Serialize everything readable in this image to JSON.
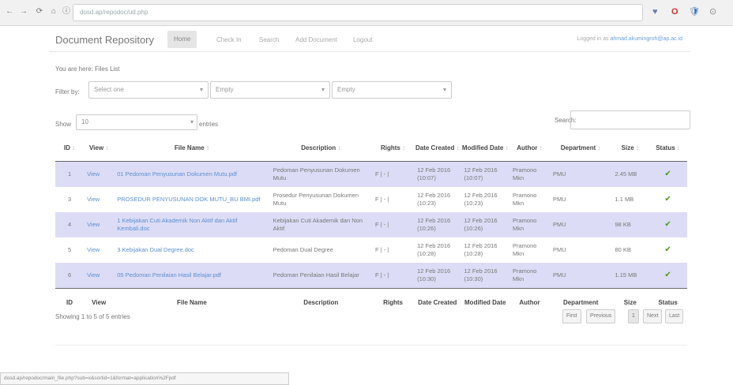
{
  "browser": {
    "url": "dosd.ap/repodoc/ud.php",
    "back_glyph": "←",
    "forward_glyph": "→",
    "reload_glyph": "⟳",
    "home_glyph": "⌂",
    "info_glyph": "ⓘ",
    "ext_glyphs": [
      "♥",
      "O",
      "🛡",
      "⊙"
    ],
    "status_url": "dosd.ap/repodoc/main_file.php?sub=x&sortid=1&format=application%2Fpdf"
  },
  "navbar": {
    "brand": "Document Repository",
    "links": [
      "Home",
      "Check In",
      "Search",
      "Add Document",
      "Logout"
    ],
    "logged_prefix": "Logged in as",
    "logged_user": "ahmad.akumingroh@ap.ac.id"
  },
  "breadcrumb": "You are here: Files List",
  "filter": {
    "label": "Filter by:",
    "selects": [
      "Select one",
      "Empty",
      "Empty"
    ]
  },
  "length_control": {
    "show_label": "Show",
    "value": "10",
    "entries_label": "entries"
  },
  "search": {
    "label": "Search:",
    "value": ""
  },
  "table": {
    "headers": [
      "ID",
      "View",
      "File Name",
      "Description",
      "Rights",
      "Date Created",
      "Modified Date",
      "Author",
      "Department",
      "Size",
      "Status"
    ],
    "header_sort_glyph": "↕",
    "rows": [
      {
        "id": "1",
        "view": "View",
        "file": "01 Pedoman Penyusunan Dokumen Mutu.pdf",
        "desc": "Pedoman Penyusunan Dokumen Mutu",
        "rights": "F | - |",
        "created": "12 Feb 2016 (10:07)",
        "modified": "12 Feb 2016 (10:07)",
        "author": "Pramono Mkn",
        "dept": "PMU",
        "size": "2.45 MB",
        "status": "✔"
      },
      {
        "id": "3",
        "view": "View",
        "file": "PROSEDUR PENYUSUNAN DOK MUTU_BU BMI.pdf",
        "desc": "Prosedur Penyusunan Dokumen Mutu",
        "rights": "F | - |",
        "created": "12 Feb 2016 (10:23)",
        "modified": "12 Feb 2016 (10:23)",
        "author": "Pramono Mkn",
        "dept": "PMU",
        "size": "1.1 MB",
        "status": "✔"
      },
      {
        "id": "4",
        "view": "View",
        "file": "1 Kebijakan Cuti Akademik Non Aktif dan Aktif Kembali.doc",
        "desc": "Kebijakan Cuti Akademik dan Non Aktif",
        "rights": "F | - |",
        "created": "12 Feb 2016 (10:26)",
        "modified": "12 Feb 2016 (10:26)",
        "author": "Pramono Mkn",
        "dept": "PMU",
        "size": "98 KB",
        "status": "✔"
      },
      {
        "id": "5",
        "view": "View",
        "file": "3 Kebijakan Dual Degree.doc",
        "desc": "Pedoman Dual Degree",
        "rights": "F | - |",
        "created": "12 Feb 2016 (10:28)",
        "modified": "12 Feb 2016 (10:28)",
        "author": "Pramono Mkn",
        "dept": "PMU",
        "size": "80 KB",
        "status": "✔"
      },
      {
        "id": "6",
        "view": "View",
        "file": "05 Pedoman Penilaian Hasil Belajar.pdf",
        "desc": "Pedoman Penilaian Hasil Belajar",
        "rights": "F | - |",
        "created": "12 Feb 2016 (10:30)",
        "modified": "12 Feb 2016 (10:30)",
        "author": "Pramono Mkn",
        "dept": "PMU",
        "size": "1.15 MB",
        "status": "✔"
      }
    ]
  },
  "info": "Showing 1 to 5 of 5 entries",
  "pagination": [
    "First",
    "Previous",
    "1",
    "Next",
    "Last"
  ],
  "colors": {
    "row_highlight": "#dcdcf6",
    "link": "#5b8fd0",
    "status_ok": "#4a9a1e"
  }
}
